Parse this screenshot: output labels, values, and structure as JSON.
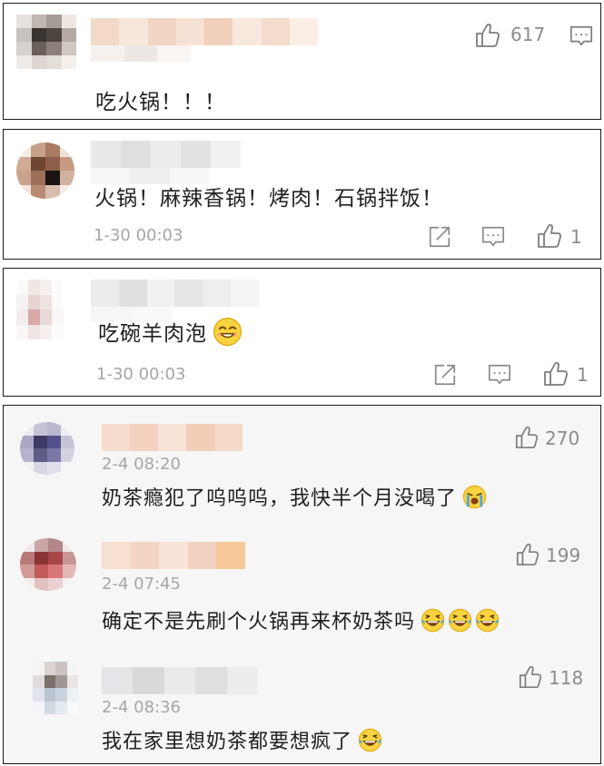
{
  "comments": [
    {
      "text": "吃火锅！！！",
      "likes": "617",
      "icons": [
        "like-icon",
        "comment-icon"
      ]
    },
    {
      "text": "火锅！麻辣香锅！烤肉！石锅拌饭！",
      "timestamp": "1-30 00:03",
      "likes": "1",
      "icons": [
        "share-icon",
        "comment-icon",
        "like-icon"
      ]
    },
    {
      "text": "吃碗羊肉泡",
      "emoji": "smile-emoji",
      "timestamp": "1-30 00:03",
      "likes": "1",
      "icons": [
        "share-icon",
        "comment-icon",
        "like-icon"
      ]
    }
  ],
  "replies": [
    {
      "timestamp": "2-4 08:20",
      "text": "奶茶瘾犯了呜呜呜，我快半个月没喝了",
      "emoji": "crying-emoji",
      "likes": "270",
      "icons": [
        "like-icon"
      ]
    },
    {
      "timestamp": "2-4 07:45",
      "text": "确定不是先刷个火锅再来杯奶茶吗",
      "emoji": "laugh-cry-emoji x3",
      "likes": "199",
      "icons": [
        "like-icon"
      ]
    },
    {
      "timestamp": "2-4 08:36",
      "text": "我在家里想奶茶都要想疯了",
      "emoji": "laugh-cry-emoji",
      "likes": "118",
      "icons": [
        "like-icon"
      ]
    }
  ]
}
